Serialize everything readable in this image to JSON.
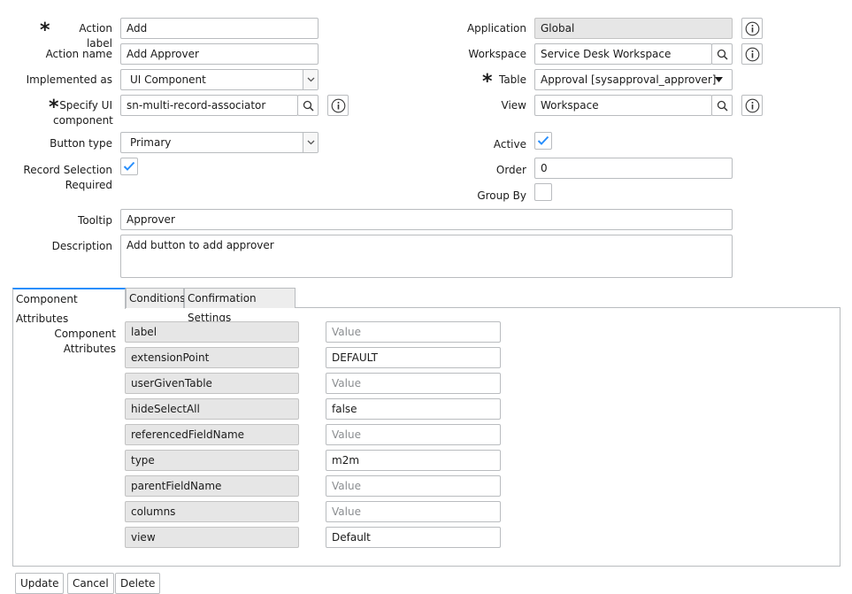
{
  "form": {
    "action_label": {
      "label": "Action label",
      "value": "Add"
    },
    "action_name": {
      "label": "Action name",
      "value": "Add Approver"
    },
    "implemented_as": {
      "label": "Implemented as",
      "value": "UI Component"
    },
    "specify_ui_component": {
      "label_line1": "Specify UI",
      "label_line2": "component",
      "value": "sn-multi-record-associator"
    },
    "button_type": {
      "label": "Button type",
      "value": "Primary"
    },
    "record_selection": {
      "label_line1": "Record Selection",
      "label_line2": "Required",
      "checked": true
    },
    "application": {
      "label": "Application",
      "value": "Global"
    },
    "workspace": {
      "label": "Workspace",
      "value": "Service Desk Workspace"
    },
    "table": {
      "label": "Table",
      "value": "Approval [sysapproval_approver]"
    },
    "view": {
      "label": "View",
      "value": "Workspace"
    },
    "active": {
      "label": "Active",
      "checked": true
    },
    "order": {
      "label": "Order",
      "value": "0"
    },
    "group_by": {
      "label": "Group By",
      "checked": false
    },
    "tooltip": {
      "label": "Tooltip",
      "value": "Approver"
    },
    "description": {
      "label": "Description",
      "value": "Add button to add approver"
    }
  },
  "tabs": [
    {
      "label": "Component Attributes",
      "active": true
    },
    {
      "label": "Conditions",
      "active": false
    },
    {
      "label": "Confirmation Settings",
      "active": false
    }
  ],
  "component_attributes": {
    "label_line1": "Component",
    "label_line2": "Attributes",
    "placeholder": "Value",
    "rows": [
      {
        "name": "label",
        "value": ""
      },
      {
        "name": "extensionPoint",
        "value": "DEFAULT"
      },
      {
        "name": "userGivenTable",
        "value": ""
      },
      {
        "name": "hideSelectAll",
        "value": "false"
      },
      {
        "name": "referencedFieldName",
        "value": ""
      },
      {
        "name": "type",
        "value": "m2m"
      },
      {
        "name": "parentFieldName",
        "value": ""
      },
      {
        "name": "columns",
        "value": ""
      },
      {
        "name": "view",
        "value": "Default"
      }
    ]
  },
  "footer": {
    "update_label": "Update",
    "cancel_label": "Cancel",
    "delete_label": "Delete"
  },
  "icons": {
    "required": "asterisk-icon",
    "lookup": "search-icon",
    "info": "info-icon",
    "dropdown": "chevron-down-icon",
    "check": "checkmark-icon"
  },
  "colors": {
    "accent": "#278efc",
    "readonly_bg": "#e6e6e6",
    "border": "#b9bcbf"
  }
}
